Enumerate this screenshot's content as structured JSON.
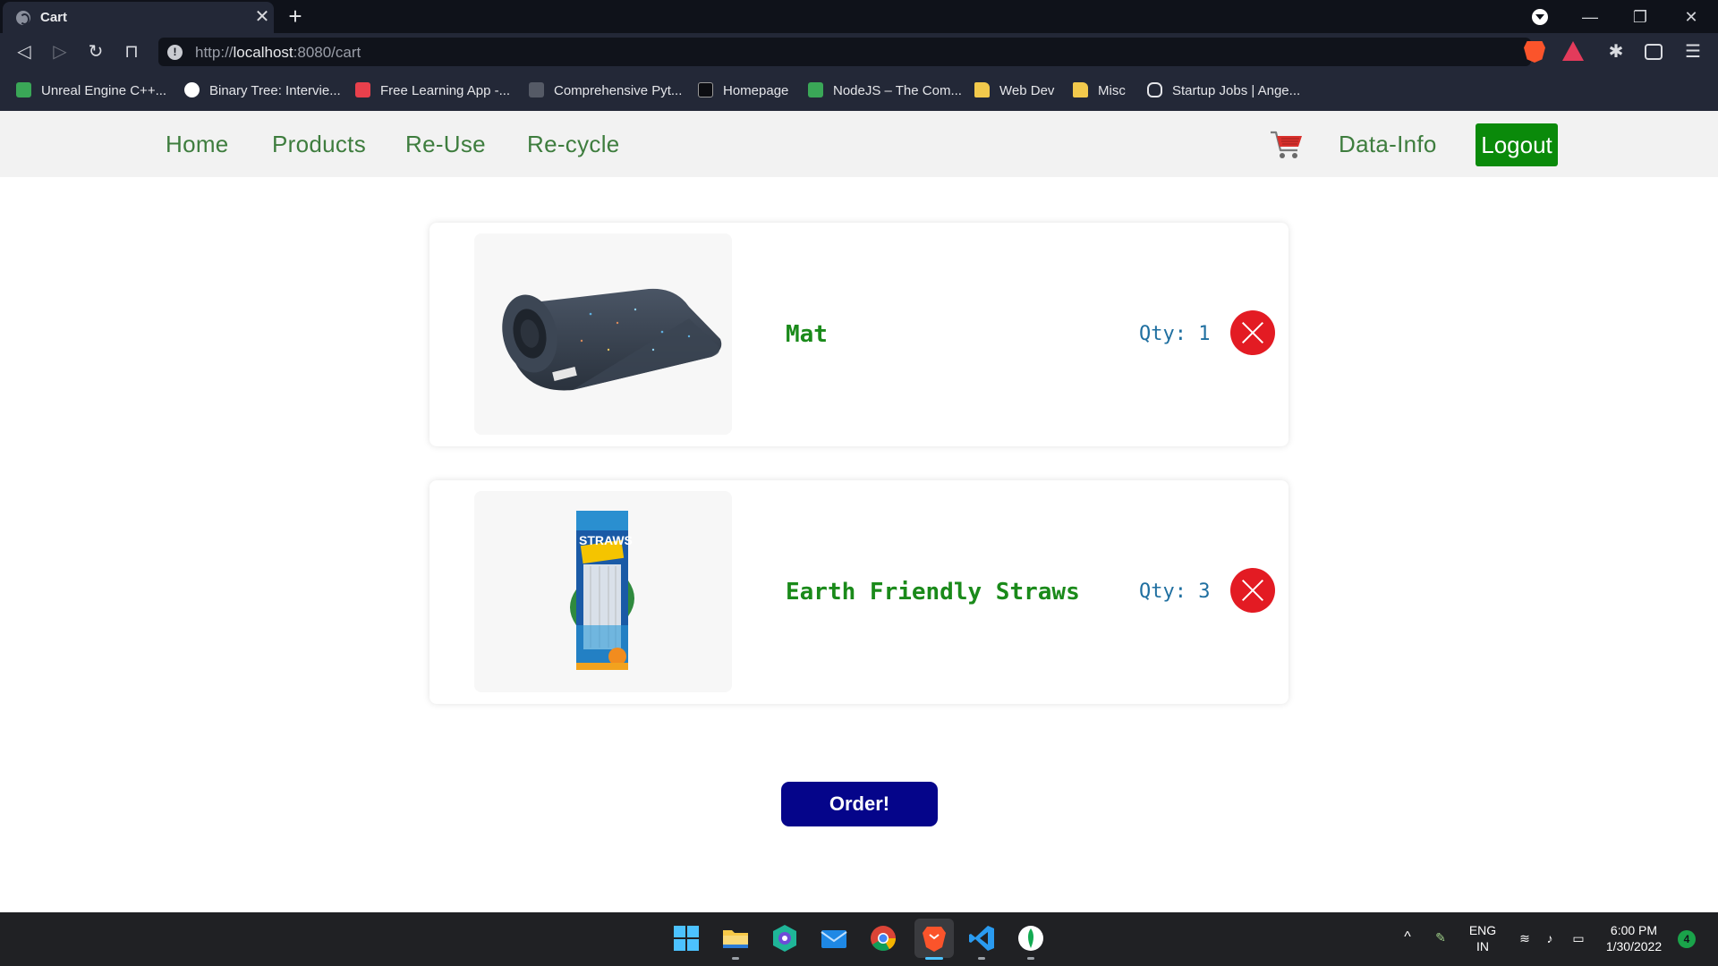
{
  "browser": {
    "tab_title": "Cart",
    "tab_close": "✕",
    "new_tab": "+",
    "url_prefix": "http://",
    "url_host": "localhost",
    "url_rest": ":8080/cart",
    "bookmarks": [
      {
        "label": "Unreal Engine C++...",
        "icon": "green"
      },
      {
        "label": "Binary Tree: Intervie...",
        "icon": "white"
      },
      {
        "label": "Free Learning App -...",
        "icon": "red"
      },
      {
        "label": "Comprehensive Pyt...",
        "icon": "gray"
      },
      {
        "label": "Homepage",
        "icon": "dark"
      },
      {
        "label": "NodeJS – The Com...",
        "icon": "green"
      },
      {
        "label": "Web Dev",
        "icon": "folder"
      },
      {
        "label": "Misc",
        "icon": "folder"
      },
      {
        "label": "Startup Jobs | Ange...",
        "icon": "hand"
      }
    ]
  },
  "navbar": {
    "links": [
      "Home",
      "Products",
      "Re-Use",
      "Re-cycle"
    ],
    "data_info": "Data-Info",
    "logout": "Logout",
    "cart_icon": "cart-icon"
  },
  "cart": {
    "items": [
      {
        "name": "Mat",
        "qty_label": "Qty: 1",
        "image": "rolled-yoga-mat"
      },
      {
        "name": "Earth Friendly Straws",
        "qty_label": "Qty: 3",
        "image": "straws-pack"
      }
    ],
    "straw_pack_text": "STRAWS",
    "order_button": "Order!"
  },
  "taskbar": {
    "language": "ENG",
    "region": "IN",
    "time": "6:00 PM",
    "date": "1/30/2022",
    "notifications": "4"
  },
  "colors": {
    "nav_link": "#3e7d3e",
    "logout_bg": "#0a8a0a",
    "item_name": "#1a8a1a",
    "qty": "#1f6fa0",
    "remove": "#e31b23",
    "order_bg": "#05058a"
  }
}
